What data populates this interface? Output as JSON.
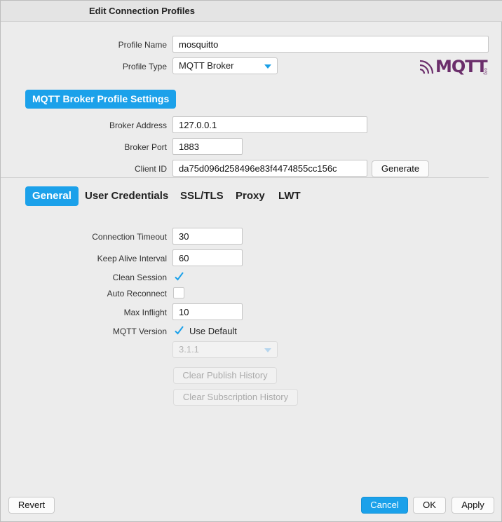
{
  "window": {
    "title": "Edit Connection Profiles"
  },
  "profile": {
    "name_label": "Profile Name",
    "name_value": "mosquitto",
    "type_label": "Profile Type",
    "type_value": "MQTT Broker",
    "logo_text": "MQTT",
    "logo_small": "org"
  },
  "broker_settings": {
    "section_title": "MQTT Broker Profile Settings",
    "address_label": "Broker Address",
    "address_value": "127.0.0.1",
    "port_label": "Broker Port",
    "port_value": "1883",
    "client_id_label": "Client ID",
    "client_id_value": "da75d096d258496e83f4474855cc156c",
    "generate_label": "Generate"
  },
  "tabs": [
    {
      "label": "General",
      "active": true
    },
    {
      "label": "User Credentials",
      "active": false
    },
    {
      "label": "SSL/TLS",
      "active": false
    },
    {
      "label": "Proxy",
      "active": false
    },
    {
      "label": "LWT",
      "active": false
    }
  ],
  "general": {
    "timeout_label": "Connection Timeout",
    "timeout_value": "30",
    "keepalive_label": "Keep Alive Interval",
    "keepalive_value": "60",
    "clean_session_label": "Clean Session",
    "clean_session_checked": true,
    "auto_reconnect_label": "Auto Reconnect",
    "auto_reconnect_checked": false,
    "max_inflight_label": "Max Inflight",
    "max_inflight_value": "10",
    "mqtt_version_label": "MQTT Version",
    "use_default_label": "Use Default",
    "use_default_checked": true,
    "version_value": "3.1.1",
    "clear_publish_label": "Clear Publish History",
    "clear_subscription_label": "Clear Subscription History"
  },
  "footer": {
    "revert_label": "Revert",
    "cancel_label": "Cancel",
    "ok_label": "OK",
    "apply_label": "Apply"
  },
  "colors": {
    "accent": "#1ba1ea",
    "logo": "#6b2e6b"
  }
}
